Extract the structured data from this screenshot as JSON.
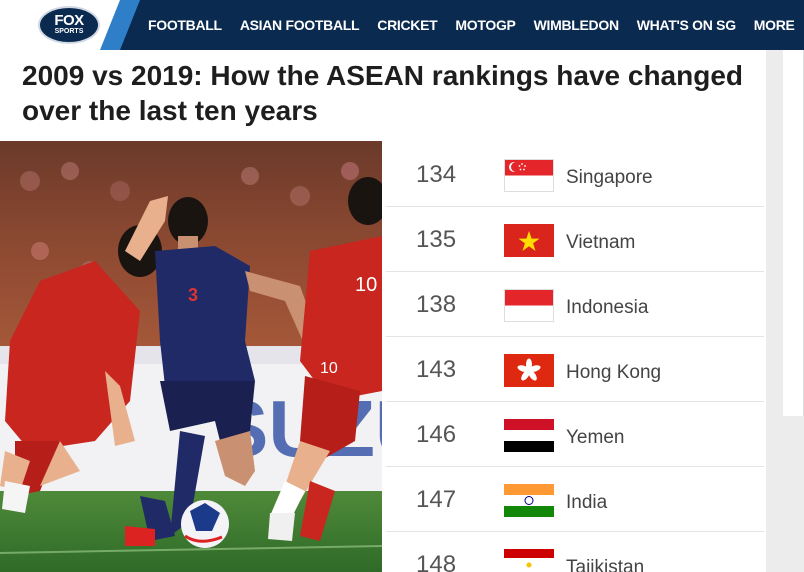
{
  "header": {
    "logo": {
      "line1": "FOX",
      "line2": "SPORTS"
    },
    "nav": [
      {
        "label": "FOOTBALL"
      },
      {
        "label": "ASIAN FOOTBALL"
      },
      {
        "label": "CRICKET"
      },
      {
        "label": "MOTOGP"
      },
      {
        "label": "WIMBLEDON"
      },
      {
        "label": "WHAT'S ON SG"
      },
      {
        "label": "MORE"
      }
    ]
  },
  "article": {
    "headline": "2009 vs 2019: How the ASEAN rankings have changed over the last ten years",
    "photo_banner_text": "SUZU"
  },
  "rankings": [
    {
      "rank": "134",
      "country": "Singapore",
      "flag": "singapore-flag"
    },
    {
      "rank": "135",
      "country": "Vietnam",
      "flag": "vietnam-flag"
    },
    {
      "rank": "138",
      "country": "Indonesia",
      "flag": "indonesia-flag"
    },
    {
      "rank": "143",
      "country": "Hong Kong",
      "flag": "hong-kong-flag"
    },
    {
      "rank": "146",
      "country": "Yemen",
      "flag": "yemen-flag"
    },
    {
      "rank": "147",
      "country": "India",
      "flag": "india-flag"
    },
    {
      "rank": "148",
      "country": "Tajikistan",
      "flag": "tajikistan-flag"
    }
  ],
  "colors": {
    "header_bg": "#0b2a4f",
    "accent_blue": "#2f7fc8"
  }
}
